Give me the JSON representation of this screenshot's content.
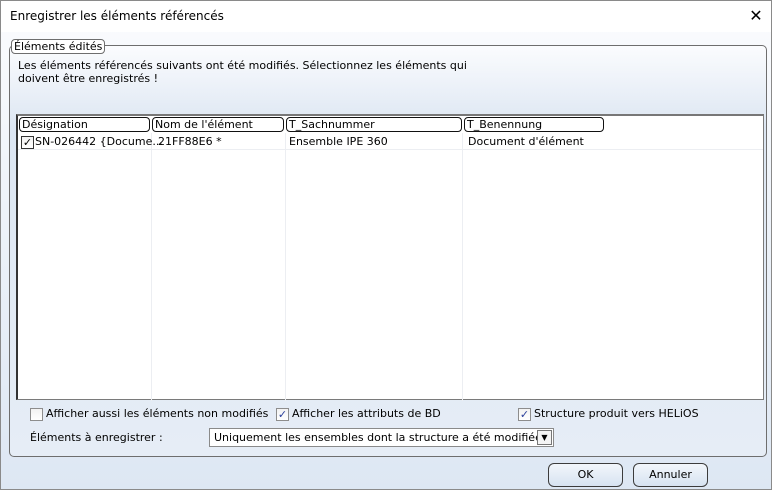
{
  "window": {
    "title": "Enregistrer les éléments référencés"
  },
  "group": {
    "legend": "Éléments édités",
    "description": "Les éléments référencés suivants ont été modifiés. Sélectionnez les éléments qui doivent être enregistrés !"
  },
  "table": {
    "columns": [
      "Désignation",
      "Nom de l'élément",
      "T_Sachnummer",
      "T_Benennung"
    ],
    "rows": [
      {
        "checked": true,
        "designation": "SN-026442 {Docume...",
        "nom": "21FF88E6 *",
        "sachnummer": "Ensemble IPE 360",
        "benennung": "Document d'élément"
      }
    ]
  },
  "options": {
    "show_unmodified": {
      "label": "Afficher aussi les éléments non modifiés",
      "checked": false
    },
    "show_db_attrs": {
      "label": "Afficher les attributs de BD",
      "checked": true
    },
    "structure_helios": {
      "label": "Structure produit vers HELiOS",
      "checked": true
    }
  },
  "save": {
    "label": "Éléments à enregistrer :",
    "selected": "Uniquement les ensembles dont la structure a été modifiée"
  },
  "buttons": {
    "ok": "OK",
    "cancel": "Annuler"
  }
}
